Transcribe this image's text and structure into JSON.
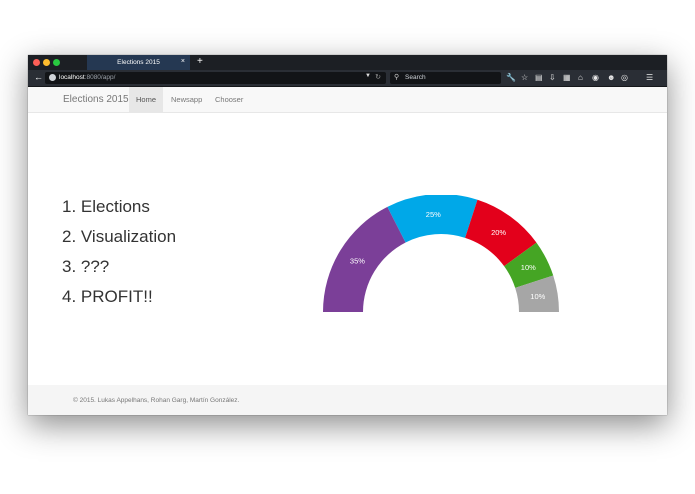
{
  "browser": {
    "tab_title": "Elections 2015",
    "tab_close": "×",
    "new_tab": "+",
    "url_host": "localhost",
    "url_path": ":8080/app/",
    "search_placeholder": "Search"
  },
  "navbar": {
    "brand": "Elections 2015",
    "items": [
      {
        "label": "Home",
        "active": true
      },
      {
        "label": "Newsapp",
        "active": false
      },
      {
        "label": "Chooser",
        "active": false
      }
    ]
  },
  "steps": [
    "1. Elections",
    "2. Visualization",
    "3. ???",
    "4. PROFIT!!"
  ],
  "chart_data": {
    "type": "pie",
    "variant": "half-donut",
    "slices": [
      {
        "label": "35%",
        "value": 35,
        "color": "#7b3f98"
      },
      {
        "label": "25%",
        "value": 25,
        "color": "#00a8e8"
      },
      {
        "label": "20%",
        "value": 20,
        "color": "#e3001b"
      },
      {
        "label": "10%",
        "value": 10,
        "color": "#45a524"
      },
      {
        "label": "10%",
        "value": 10,
        "color": "#a6a6a6"
      }
    ]
  },
  "footer": {
    "text": "© 2015. Lukas Appelhans, Rohan Garg, Martín González."
  }
}
